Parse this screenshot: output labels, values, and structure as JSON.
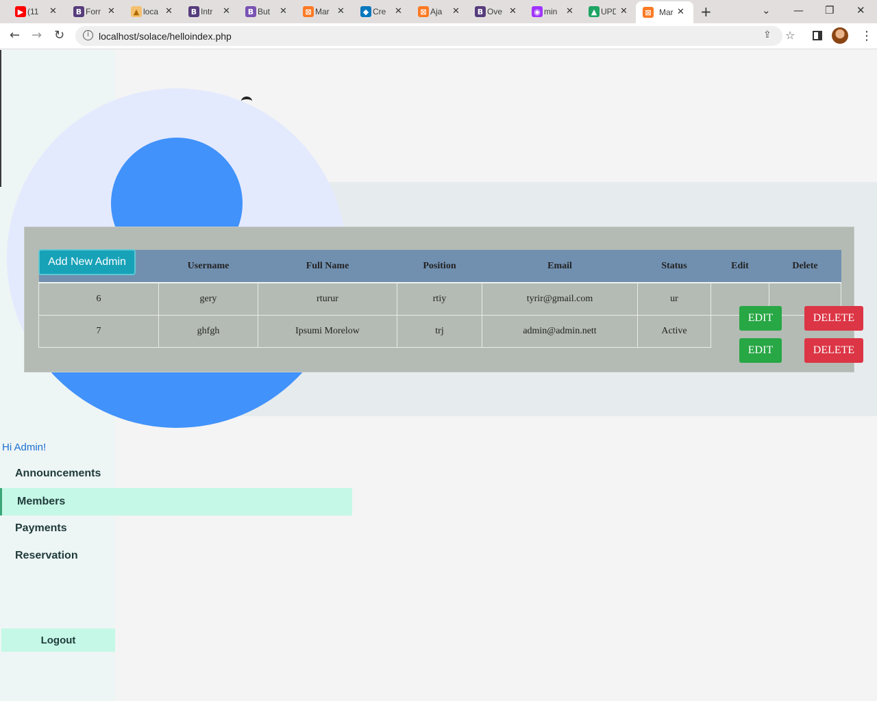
{
  "browser": {
    "tabs": [
      {
        "title": "(11",
        "icon": "youtube-icon",
        "color": "#ff0000",
        "glyph": "▶"
      },
      {
        "title": "Forr",
        "icon": "bootstrap-icon",
        "color": "#563d7c",
        "glyph": "B"
      },
      {
        "title": "loca",
        "icon": "phpmyadmin-icon",
        "color": "#e8a33d",
        "glyph": "▲"
      },
      {
        "title": "Intr",
        "icon": "bootstrap-icon",
        "color": "#563d7c",
        "glyph": "B"
      },
      {
        "title": "But",
        "icon": "bootstrap-icon",
        "color": "#7952b3",
        "glyph": "B"
      },
      {
        "title": "Mar",
        "icon": "xampp-icon",
        "color": "#fb7a24",
        "glyph": "⊠"
      },
      {
        "title": "Cre",
        "icon": "drupal-icon",
        "color": "#0678be",
        "glyph": "◆"
      },
      {
        "title": "Aja",
        "icon": "xampp-icon",
        "color": "#fb7a24",
        "glyph": "⊠"
      },
      {
        "title": "Ove",
        "icon": "bootstrap-icon",
        "color": "#563d7c",
        "glyph": "B"
      },
      {
        "title": "min",
        "icon": "messenger-icon",
        "color": "#a033ff",
        "glyph": "◉"
      },
      {
        "title": "UPD",
        "icon": "google-drive-icon",
        "color": "#1fa463",
        "glyph": "▲"
      },
      {
        "title": "Mar",
        "icon": "xampp-icon",
        "color": "#fb7a24",
        "glyph": "⊠"
      }
    ],
    "url": "localhost/solace/helloindex.php"
  },
  "admin_table": {
    "add_button": "Add New Admin",
    "headers": [
      "",
      "Username",
      "Full Name",
      "Position",
      "Email",
      "Status",
      "Edit",
      "Delete"
    ],
    "rows": [
      {
        "id": "6",
        "username": "gery",
        "full_name": "rturur",
        "position": "rtiy",
        "email": "tyrir@gmail.com",
        "status": "ur"
      },
      {
        "id": "7",
        "username": "ghfgh",
        "full_name": "Ipsumi Morelow",
        "position": "trj",
        "email": "admin@admin.nett",
        "status": "Active"
      }
    ],
    "edit_label": "EDIT",
    "delete_label": "DELETE"
  },
  "sidebar": {
    "greeting": "Hi Admin!",
    "items": [
      {
        "label": "Announcements",
        "active": false
      },
      {
        "label": "Members",
        "active": true
      },
      {
        "label": "Payments",
        "active": false
      },
      {
        "label": "Reservation",
        "active": false
      }
    ],
    "logout": "Logout"
  },
  "colors": {
    "accent": "#17a2b8",
    "edit": "#28a745",
    "delete": "#dc3545",
    "table_header": "#7190b0",
    "nav_active": "#c5f8e6"
  }
}
